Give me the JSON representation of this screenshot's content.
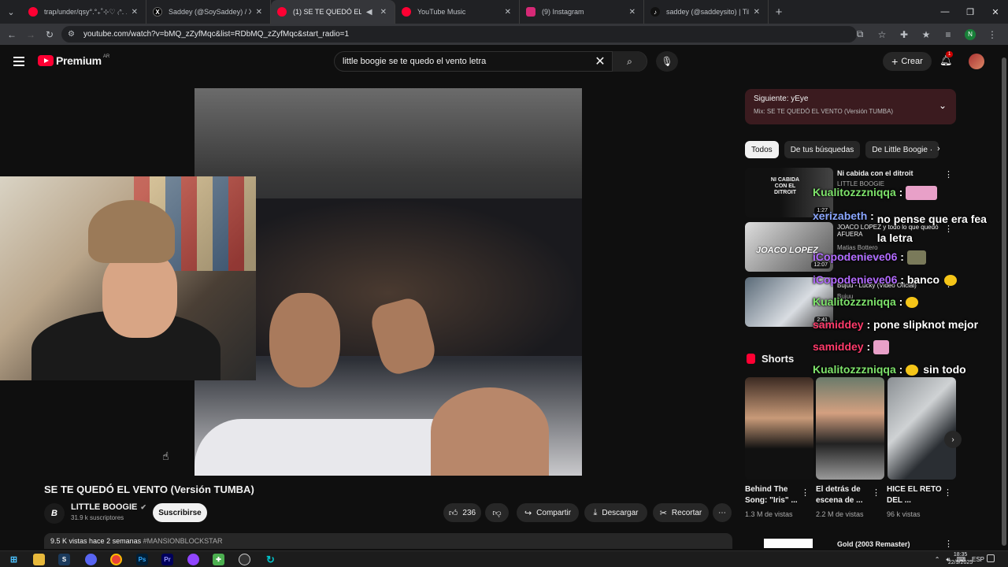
{
  "browser": {
    "tabs": [
      {
        "title": "trap/under/qsy°.°₊˚⊹♡ ₍ᐢ. .ᐢ₎ ₊˚⊹",
        "favicon_color": "#ff0033"
      },
      {
        "title": "Saddey (@SoySaddey) / X",
        "favicon_color": "#000000"
      },
      {
        "title": "(1) SE TE QUEDÓ EL VENTO",
        "favicon_color": "#ff0033"
      },
      {
        "title": "YouTube Music",
        "favicon_color": "#ff0033"
      },
      {
        "title": "(9) Instagram",
        "favicon_color": "#d62976"
      },
      {
        "title": "saddey (@saddeysito) | TikTok",
        "favicon_color": "#111111"
      }
    ],
    "url": "youtube.com/watch?v=bMQ_zZyfMqc&list=RDbMQ_zZyfMqc&start_radio=1",
    "profile_initial": "N"
  },
  "youtube": {
    "logo_text": "Premium",
    "country": "AR",
    "search_query": "little boogie se te quedo el vento letra",
    "create_label": "Crear",
    "notif_count": "1"
  },
  "video": {
    "title": "SE TE QUEDÓ EL VENTO (Versión TUMBA)",
    "channel": "LITTLE BOOGIE",
    "subscribers": "31.9 k suscriptores",
    "subscribe_label": "Suscribirse",
    "likes": "236",
    "share_label": "Compartir",
    "download_label": "Descargar",
    "clip_label": "Recortar",
    "views": "9.5 K vistas",
    "age": "hace 2 semanas",
    "hashtag": "#MANSIONBLOCKSTAR"
  },
  "sidebar": {
    "next_label": "Siguiente: yEye",
    "next_mix": "Mix: SE TE QUEDÓ EL VENTO (Versión TUMBA)",
    "chips": [
      "Todos",
      "De tus búsquedas",
      "De Little Boogie · "
    ],
    "recs": [
      {
        "title": "Ni cabida con el ditroit",
        "channel": "LITTLE BOOGIE",
        "duration": "1:27",
        "thumb_text": "NI CABIDA CON EL DITROIT"
      },
      {
        "title": "JOACO LOPEZ y todo lo que quedó AFUERA",
        "channel": "Matias Bottero",
        "extra": "Solo miembros",
        "duration": "12:07",
        "thumb_text": "JOACO LOPEZ"
      },
      {
        "title": "Bujuu - Lucky (Video Oficial)",
        "channel": "Bujuu",
        "duration": "2:41",
        "thumb_text": ""
      }
    ],
    "shorts_label": "Shorts",
    "shorts": [
      {
        "title": "Behind The Song: \"Iris\" ...",
        "views": "1.3 M de vistas"
      },
      {
        "title": "El detrás de escena de ...",
        "views": "2.2 M de vistas"
      },
      {
        "title": "HICE EL RETO DEL ...",
        "views": "96 k vistas"
      }
    ],
    "last_title": "Gold (2003 Remaster)"
  },
  "chat": [
    {
      "user": "Kualitozzzniqqa",
      "text": "",
      "color": "#7ee36b"
    },
    {
      "user": "xerizabeth",
      "text": "no pense que era fea la letra",
      "color": "#8aa6ff"
    },
    {
      "user": "iCopodenieve06",
      "text": "",
      "color": "#b36bff"
    },
    {
      "user": "iCopodenieve06",
      "text": "banco",
      "color": "#b36bff"
    },
    {
      "user": "Kualitozzzniqqa",
      "text": "",
      "color": "#7ee36b"
    },
    {
      "user": "samiddey",
      "text": "pone slipknot mejor",
      "color": "#ff3b6b"
    },
    {
      "user": "samiddey",
      "text": "",
      "color": "#ff3b6b"
    },
    {
      "user": "Kualitozzzniqqa",
      "text": "sin todo",
      "color": "#7ee36b"
    }
  ],
  "taskbar": {
    "lang": "ESP",
    "time": "18:35",
    "date": "22/9/2025"
  }
}
